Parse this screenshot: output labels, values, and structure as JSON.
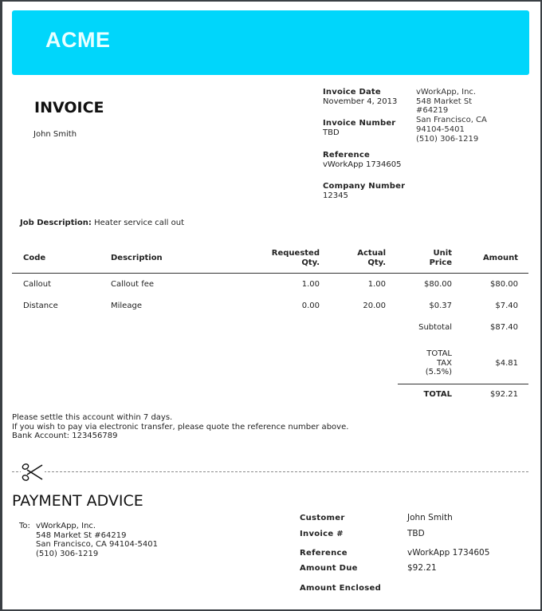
{
  "brand": {
    "logo_text": "ACME",
    "header_color": "#00d6fb"
  },
  "invoice": {
    "title": "INVOICE",
    "customer_name": "John Smith",
    "meta": [
      {
        "label": "Invoice Date",
        "value": "November 4, 2013"
      },
      {
        "label": "Invoice Number",
        "value": "TBD"
      },
      {
        "label": "Reference",
        "value": "vWorkApp 1734605"
      },
      {
        "label": "Company Number",
        "value": "12345"
      }
    ],
    "company_address": [
      "vWorkApp, Inc.",
      "548 Market St",
      "#64219",
      "San Francisco, CA",
      "94104-5401",
      "(510) 306-1219"
    ],
    "job_description": {
      "label": "Job Description:",
      "value": "Heater service call out"
    }
  },
  "table": {
    "headers": {
      "code": "Code",
      "description": "Description",
      "requested_qty": [
        "Requested",
        "Qty."
      ],
      "actual_qty": [
        "Actual",
        "Qty."
      ],
      "unit_price": [
        "Unit",
        "Price"
      ],
      "amount": "Amount"
    },
    "rows": [
      {
        "code": "Callout",
        "description": "Callout fee",
        "requested_qty": "1.00",
        "actual_qty": "1.00",
        "unit_price": "$80.00",
        "amount": "$80.00"
      },
      {
        "code": "Distance",
        "description": "Mileage",
        "requested_qty": "0.00",
        "actual_qty": "20.00",
        "unit_price": "$0.37",
        "amount": "$7.40"
      }
    ],
    "subtotal": {
      "label": "Subtotal",
      "value": "$87.40"
    },
    "tax": {
      "label": [
        "TOTAL",
        "TAX",
        "(5.5%)"
      ],
      "value": "$4.81"
    },
    "total": {
      "label": "TOTAL",
      "value": "$92.21"
    }
  },
  "notes": [
    "Please settle this account within 7 days.",
    "If you wish to pay via electronic transfer, please quote the reference number above.",
    "Bank Account: 123456789"
  ],
  "payment_advice": {
    "title": "PAYMENT ADVICE",
    "to_label": "To:",
    "to_lines": [
      "vWorkApp, Inc.",
      "548 Market St #64219",
      "San Francisco, CA 94104-5401",
      "(510) 306-1219"
    ],
    "fields": [
      {
        "label": "Customer",
        "value": "John Smith"
      },
      {
        "label": "Invoice #",
        "value": "TBD"
      },
      {
        "label": "Reference",
        "value": "vWorkApp 1734605"
      },
      {
        "label": "Amount Due",
        "value": "$92.21"
      },
      {
        "label": "Amount Enclosed",
        "value": ""
      }
    ]
  }
}
